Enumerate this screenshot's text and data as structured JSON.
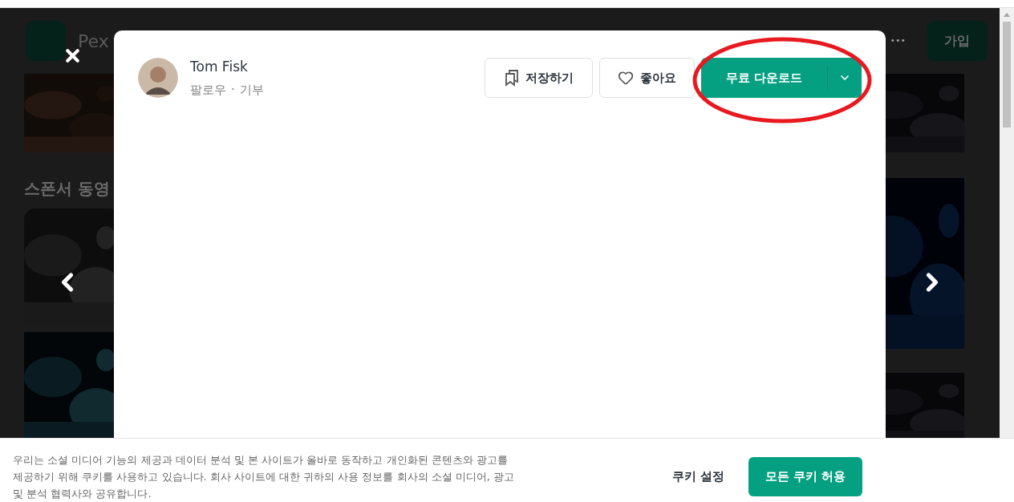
{
  "background_page": {
    "logo_text": "Pex",
    "section_heading": "스폰서 동영",
    "more": "•••",
    "signup_button": "가입"
  },
  "modal": {
    "author": {
      "name": "Tom Fisk",
      "follow_link": "팔로우",
      "separator": "·",
      "donate_link": "기부"
    },
    "actions": [
      {
        "kind": "save",
        "label": "저장하기"
      },
      {
        "kind": "like",
        "label": "좋아요"
      }
    ],
    "download": {
      "label": "무료 다운로드"
    }
  },
  "cookie_banner": {
    "text": "우리는 소셜 미디어 기능의 제공과 데이터 분석 및 본 사이트가 올바로 동작하고 개인화된 콘텐츠와 광고를 제공하기 위해 쿠키를 사용하고 있습니다. 회사 사이트에 대한 귀하의 사용 정보를 회사의 소셜 미디어, 광고 및 분석 협력사와 공유합니다.",
    "settings_button": "쿠키 설정",
    "accept_button": "모든 쿠키 허용"
  }
}
